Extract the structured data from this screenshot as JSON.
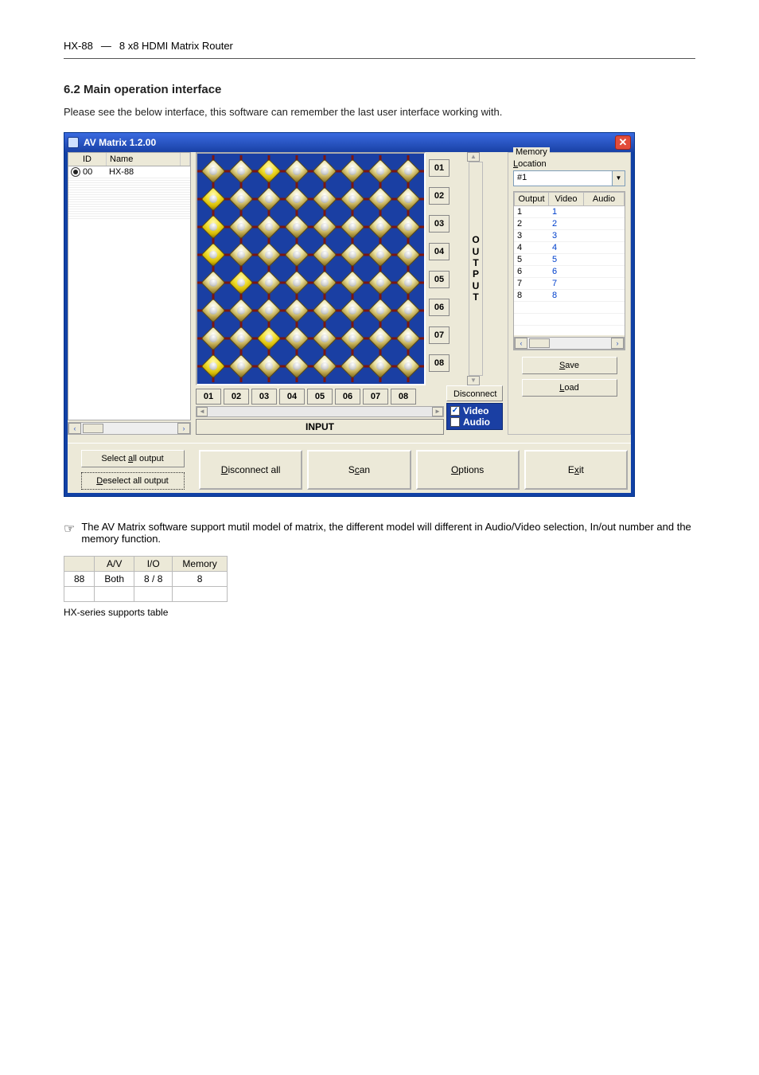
{
  "doc_header": {
    "left": "HX-88",
    "sep": "—",
    "right": "8 x8 HDMI Matrix Router"
  },
  "section_title": "6.2 Main operation interface",
  "intro_text": "Please see the below interface, this software can remember the last user interface working with.",
  "window": {
    "title": "AV Matrix 1.2.00",
    "device_list": {
      "cols": {
        "id": "ID",
        "name": "Name"
      },
      "rows": [
        {
          "id": "00",
          "name": "HX-88",
          "selected": true
        }
      ]
    },
    "matrix": {
      "output_labels": [
        "01",
        "02",
        "03",
        "04",
        "05",
        "06",
        "07",
        "08"
      ],
      "output_word": "OUTPUT",
      "input_labels": [
        "01",
        "02",
        "03",
        "04",
        "05",
        "06",
        "07",
        "08"
      ],
      "input_bar": "INPUT",
      "active_cells": [
        {
          "r": 0,
          "c": 2
        },
        {
          "r": 1,
          "c": 0
        },
        {
          "r": 2,
          "c": 0
        },
        {
          "r": 3,
          "c": 0
        },
        {
          "r": 4,
          "c": 1
        },
        {
          "r": 6,
          "c": 2
        },
        {
          "r": 7,
          "c": 0
        }
      ],
      "disconnect_btn": "Disconnect",
      "video_label": "Video",
      "audio_label": "Audio",
      "video_checked": true,
      "audio_checked": false
    },
    "memory": {
      "legend": "Memory",
      "location_label": "Location",
      "location_value": "#1",
      "cols": {
        "output": "Output",
        "video": "Video",
        "audio": "Audio"
      },
      "rows": [
        {
          "o": "1",
          "v": "1",
          "a": ""
        },
        {
          "o": "2",
          "v": "2",
          "a": ""
        },
        {
          "o": "3",
          "v": "3",
          "a": ""
        },
        {
          "o": "4",
          "v": "4",
          "a": ""
        },
        {
          "o": "5",
          "v": "5",
          "a": ""
        },
        {
          "o": "6",
          "v": "6",
          "a": ""
        },
        {
          "o": "7",
          "v": "7",
          "a": ""
        },
        {
          "o": "8",
          "v": "8",
          "a": ""
        }
      ],
      "save_btn": "Save",
      "load_btn": "Load"
    },
    "left_group": {
      "select_all": "Select all output",
      "deselect_all": "Deselect all output"
    },
    "bottom": {
      "disconnect_all": "Disconnect all",
      "scan": "Scan",
      "options": "Options",
      "exit": "Exit",
      "underline": {
        "disconnect_all": "D",
        "scan": "c",
        "options": "O",
        "exit": "x",
        "select_all": "a",
        "deselect_all": "D",
        "save": "S",
        "load": "L"
      }
    }
  },
  "note_text": "The AV Matrix software support mutil model of matrix, the different model will different in Audio/Video selection, In/out number and the memory function.",
  "small_table": {
    "cols": [
      "",
      "A/V",
      "I/O",
      "Memory"
    ],
    "rows": [
      [
        "88",
        "Both",
        "8 / 8",
        "8"
      ],
      [
        "",
        "",
        "",
        ""
      ]
    ]
  },
  "caption": "HX-series supports table"
}
